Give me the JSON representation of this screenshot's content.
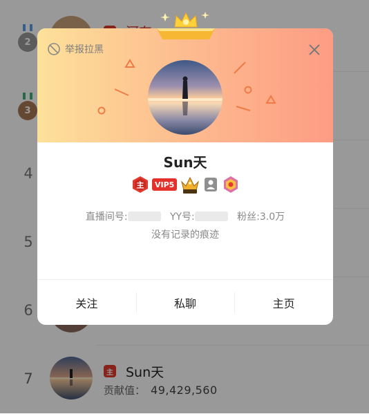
{
  "background_list": {
    "rows": [
      {
        "rank": "2",
        "name": "河东"
      },
      {
        "rank": "3",
        "name": ""
      },
      {
        "rank": "4",
        "name": ""
      },
      {
        "rank": "5",
        "name": ""
      },
      {
        "rank": "6",
        "name": ""
      },
      {
        "rank": "7",
        "name": "Sun天",
        "contrib_label": "贡献值：",
        "contrib_value": "49,429,560",
        "level_badge": "主"
      }
    ]
  },
  "modal": {
    "report_label": "举报拉黑",
    "close_icon": "close-icon",
    "user_name": "Sun天",
    "badges": {
      "level": "主",
      "vip": "VIP5"
    },
    "info": {
      "room_label": "直播间号:",
      "yy_label": "YY号:",
      "fans_label": "粉丝:",
      "fans_value": "3.0万"
    },
    "signature": "没有记录的痕迹",
    "actions": {
      "follow": "关注",
      "message": "私聊",
      "homepage": "主页"
    }
  },
  "colors": {
    "header_left": "#fde19a",
    "header_right": "#fd9c84",
    "vip_red": "#e4312b",
    "level_red": "#e23b2e",
    "overlay": "rgba(0,0,0,0.40)"
  }
}
